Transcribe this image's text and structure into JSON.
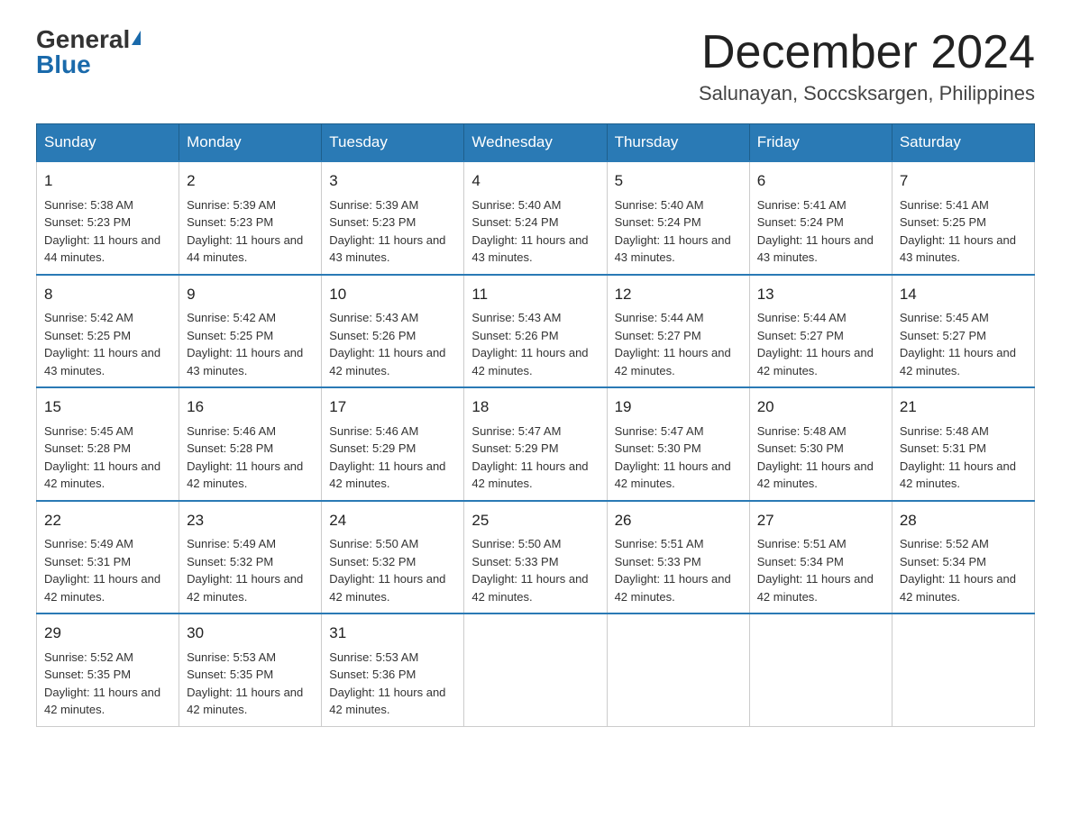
{
  "header": {
    "logo_general": "General",
    "logo_blue": "Blue",
    "month_title": "December 2024",
    "location": "Salunayan, Soccsksargen, Philippines"
  },
  "days_of_week": [
    "Sunday",
    "Monday",
    "Tuesday",
    "Wednesday",
    "Thursday",
    "Friday",
    "Saturday"
  ],
  "weeks": [
    [
      {
        "day": "1",
        "sunrise": "5:38 AM",
        "sunset": "5:23 PM",
        "daylight": "11 hours and 44 minutes."
      },
      {
        "day": "2",
        "sunrise": "5:39 AM",
        "sunset": "5:23 PM",
        "daylight": "11 hours and 44 minutes."
      },
      {
        "day": "3",
        "sunrise": "5:39 AM",
        "sunset": "5:23 PM",
        "daylight": "11 hours and 43 minutes."
      },
      {
        "day": "4",
        "sunrise": "5:40 AM",
        "sunset": "5:24 PM",
        "daylight": "11 hours and 43 minutes."
      },
      {
        "day": "5",
        "sunrise": "5:40 AM",
        "sunset": "5:24 PM",
        "daylight": "11 hours and 43 minutes."
      },
      {
        "day": "6",
        "sunrise": "5:41 AM",
        "sunset": "5:24 PM",
        "daylight": "11 hours and 43 minutes."
      },
      {
        "day": "7",
        "sunrise": "5:41 AM",
        "sunset": "5:25 PM",
        "daylight": "11 hours and 43 minutes."
      }
    ],
    [
      {
        "day": "8",
        "sunrise": "5:42 AM",
        "sunset": "5:25 PM",
        "daylight": "11 hours and 43 minutes."
      },
      {
        "day": "9",
        "sunrise": "5:42 AM",
        "sunset": "5:25 PM",
        "daylight": "11 hours and 43 minutes."
      },
      {
        "day": "10",
        "sunrise": "5:43 AM",
        "sunset": "5:26 PM",
        "daylight": "11 hours and 42 minutes."
      },
      {
        "day": "11",
        "sunrise": "5:43 AM",
        "sunset": "5:26 PM",
        "daylight": "11 hours and 42 minutes."
      },
      {
        "day": "12",
        "sunrise": "5:44 AM",
        "sunset": "5:27 PM",
        "daylight": "11 hours and 42 minutes."
      },
      {
        "day": "13",
        "sunrise": "5:44 AM",
        "sunset": "5:27 PM",
        "daylight": "11 hours and 42 minutes."
      },
      {
        "day": "14",
        "sunrise": "5:45 AM",
        "sunset": "5:27 PM",
        "daylight": "11 hours and 42 minutes."
      }
    ],
    [
      {
        "day": "15",
        "sunrise": "5:45 AM",
        "sunset": "5:28 PM",
        "daylight": "11 hours and 42 minutes."
      },
      {
        "day": "16",
        "sunrise": "5:46 AM",
        "sunset": "5:28 PM",
        "daylight": "11 hours and 42 minutes."
      },
      {
        "day": "17",
        "sunrise": "5:46 AM",
        "sunset": "5:29 PM",
        "daylight": "11 hours and 42 minutes."
      },
      {
        "day": "18",
        "sunrise": "5:47 AM",
        "sunset": "5:29 PM",
        "daylight": "11 hours and 42 minutes."
      },
      {
        "day": "19",
        "sunrise": "5:47 AM",
        "sunset": "5:30 PM",
        "daylight": "11 hours and 42 minutes."
      },
      {
        "day": "20",
        "sunrise": "5:48 AM",
        "sunset": "5:30 PM",
        "daylight": "11 hours and 42 minutes."
      },
      {
        "day": "21",
        "sunrise": "5:48 AM",
        "sunset": "5:31 PM",
        "daylight": "11 hours and 42 minutes."
      }
    ],
    [
      {
        "day": "22",
        "sunrise": "5:49 AM",
        "sunset": "5:31 PM",
        "daylight": "11 hours and 42 minutes."
      },
      {
        "day": "23",
        "sunrise": "5:49 AM",
        "sunset": "5:32 PM",
        "daylight": "11 hours and 42 minutes."
      },
      {
        "day": "24",
        "sunrise": "5:50 AM",
        "sunset": "5:32 PM",
        "daylight": "11 hours and 42 minutes."
      },
      {
        "day": "25",
        "sunrise": "5:50 AM",
        "sunset": "5:33 PM",
        "daylight": "11 hours and 42 minutes."
      },
      {
        "day": "26",
        "sunrise": "5:51 AM",
        "sunset": "5:33 PM",
        "daylight": "11 hours and 42 minutes."
      },
      {
        "day": "27",
        "sunrise": "5:51 AM",
        "sunset": "5:34 PM",
        "daylight": "11 hours and 42 minutes."
      },
      {
        "day": "28",
        "sunrise": "5:52 AM",
        "sunset": "5:34 PM",
        "daylight": "11 hours and 42 minutes."
      }
    ],
    [
      {
        "day": "29",
        "sunrise": "5:52 AM",
        "sunset": "5:35 PM",
        "daylight": "11 hours and 42 minutes."
      },
      {
        "day": "30",
        "sunrise": "5:53 AM",
        "sunset": "5:35 PM",
        "daylight": "11 hours and 42 minutes."
      },
      {
        "day": "31",
        "sunrise": "5:53 AM",
        "sunset": "5:36 PM",
        "daylight": "11 hours and 42 minutes."
      },
      null,
      null,
      null,
      null
    ]
  ]
}
